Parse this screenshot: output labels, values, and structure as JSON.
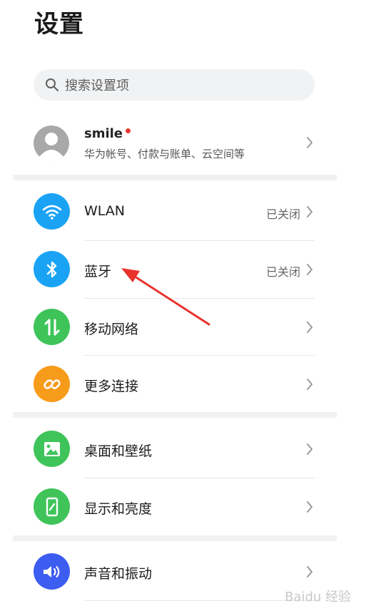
{
  "header": {
    "title": "设置"
  },
  "search": {
    "placeholder": "搜索设置项"
  },
  "account": {
    "name": "smile",
    "subtitle": "华为帐号、付款与账单、云空间等"
  },
  "items": [
    {
      "id": "wlan",
      "label": "WLAN",
      "status": "已关闭",
      "icon": "wifi-icon",
      "color": "#1aa3f5"
    },
    {
      "id": "bluetooth",
      "label": "蓝牙",
      "status": "已关闭",
      "icon": "bluetooth-icon",
      "color": "#1aa3f5"
    },
    {
      "id": "mobile-network",
      "label": "移动网络",
      "status": "",
      "icon": "mobile-data-icon",
      "color": "#3fc45a"
    },
    {
      "id": "more-connections",
      "label": "更多连接",
      "status": "",
      "icon": "link-icon",
      "color": "#f79b1a"
    },
    {
      "id": "wallpaper",
      "label": "桌面和壁纸",
      "status": "",
      "icon": "picture-icon",
      "color": "#3fc45a"
    },
    {
      "id": "display",
      "label": "显示和亮度",
      "status": "",
      "icon": "phone-brightness-icon",
      "color": "#3fc45a"
    },
    {
      "id": "sound",
      "label": "声音和振动",
      "status": "",
      "icon": "speaker-icon",
      "color": "#3d5cf0"
    }
  ],
  "annotation": {
    "arrow_color": "#e8322c"
  },
  "watermark": {
    "text": "Baidu 经验"
  }
}
